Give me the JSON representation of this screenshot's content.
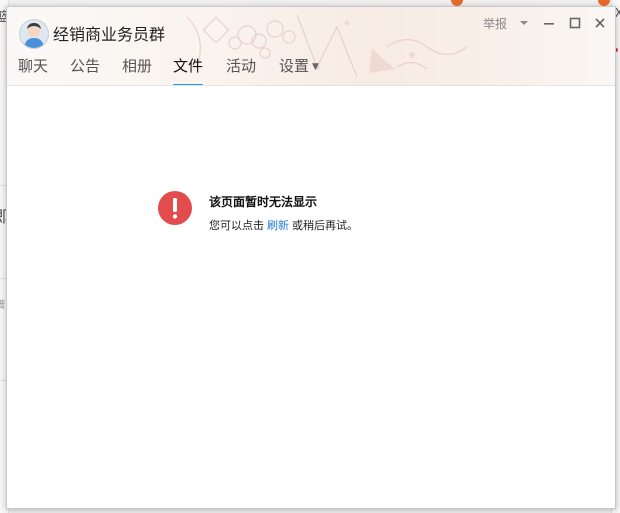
{
  "background": {
    "left_fragments": [
      "篮",
      "即",
      "谱"
    ],
    "right_fragments": [
      "Ⅸ"
    ]
  },
  "window": {
    "title": "经销商业务员群",
    "tabs": [
      {
        "label": "聊天"
      },
      {
        "label": "公告"
      },
      {
        "label": "相册"
      },
      {
        "label": "文件",
        "active": true
      },
      {
        "label": "活动"
      },
      {
        "label": "设置",
        "has_dropdown": true
      }
    ],
    "controls": {
      "report_label": "举报",
      "menu_icon": "chevron-down-icon",
      "minimize_icon": "minimize-icon",
      "maximize_icon": "maximize-icon",
      "close_icon": "close-icon"
    }
  },
  "error": {
    "icon": "exclamation-circle-icon",
    "title": "该页面暂时无法显示",
    "message_prefix": "您可以点击",
    "refresh_link": "刷新",
    "message_suffix": "或稍后再试。"
  },
  "colors": {
    "accent": "#1a9be6",
    "link": "#1e7ad6",
    "error_red": "#e24c4c"
  }
}
